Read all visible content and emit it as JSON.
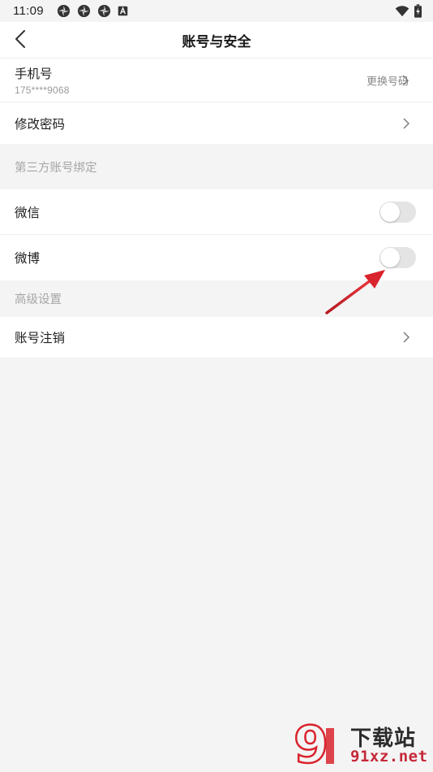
{
  "status_bar": {
    "time": "11:09",
    "icons": [
      "app-notification-icon",
      "app-notification-icon",
      "app-notification-icon",
      "a-badge-icon"
    ],
    "right_icons": [
      "wifi-icon",
      "battery-charging-icon"
    ]
  },
  "nav": {
    "title": "账号与安全",
    "back_icon": "chevron-left-icon"
  },
  "account": {
    "phone_label": "手机号",
    "phone_value": "175****9068",
    "phone_action": "更换号码",
    "password_label": "修改密码"
  },
  "third_party": {
    "header": "第三方账号绑定",
    "items": [
      {
        "label": "微信",
        "enabled": false
      },
      {
        "label": "微博",
        "enabled": false
      }
    ]
  },
  "advanced": {
    "header": "高级设置",
    "deactivate_label": "账号注销"
  },
  "watermark": {
    "title": "下载站",
    "url": "91xz.net",
    "logo_text": "9"
  },
  "colors": {
    "accent_arrow": "#d9232d",
    "toggle_off": "#e4e4e4",
    "background": "#f4f4f4"
  }
}
